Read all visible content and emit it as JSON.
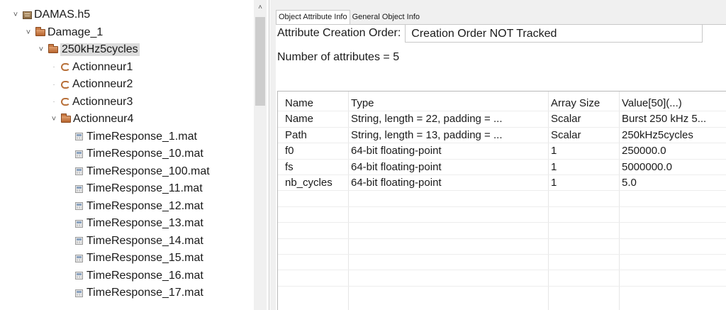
{
  "tree": {
    "items": [
      {
        "label": "DAMAS.h5",
        "icon": "hdf5-file-icon",
        "toggle": "˅",
        "indent": 0
      },
      {
        "label": "Damage_1",
        "icon": "group-folder-icon",
        "toggle": "˅",
        "indent": 1
      },
      {
        "label": "250kHz5cycles",
        "icon": "group-folder-icon",
        "toggle": "˅",
        "indent": 2,
        "selected": true
      },
      {
        "label": "Actionneur1",
        "icon": "subgroup-icon",
        "toggle": "·",
        "indent": 3
      },
      {
        "label": "Actionneur2",
        "icon": "subgroup-icon",
        "toggle": "·",
        "indent": 3
      },
      {
        "label": "Actionneur3",
        "icon": "subgroup-icon",
        "toggle": "·",
        "indent": 3
      },
      {
        "label": "Actionneur4",
        "icon": "group-folder-icon",
        "toggle": "˅",
        "indent": 3
      },
      {
        "label": "TimeResponse_1.mat",
        "icon": "dataset-icon",
        "indent": 4
      },
      {
        "label": "TimeResponse_10.mat",
        "icon": "dataset-icon",
        "indent": 4
      },
      {
        "label": "TimeResponse_100.mat",
        "icon": "dataset-icon",
        "indent": 4
      },
      {
        "label": "TimeResponse_11.mat",
        "icon": "dataset-icon",
        "indent": 4
      },
      {
        "label": "TimeResponse_12.mat",
        "icon": "dataset-icon",
        "indent": 4
      },
      {
        "label": "TimeResponse_13.mat",
        "icon": "dataset-icon",
        "indent": 4
      },
      {
        "label": "TimeResponse_14.mat",
        "icon": "dataset-icon",
        "indent": 4
      },
      {
        "label": "TimeResponse_15.mat",
        "icon": "dataset-icon",
        "indent": 4
      },
      {
        "label": "TimeResponse_16.mat",
        "icon": "dataset-icon",
        "indent": 4
      },
      {
        "label": "TimeResponse_17.mat",
        "icon": "dataset-icon",
        "indent": 4
      }
    ],
    "scroll_up_glyph": "˄"
  },
  "tabs": [
    {
      "label": "Object Attribute Info",
      "active": true
    },
    {
      "label": "General Object Info",
      "active": false
    }
  ],
  "attributes": {
    "creation_order_label": "Attribute Creation Order:",
    "creation_order_value": "Creation Order NOT Tracked",
    "count_text": "Number of attributes = 5",
    "columns": [
      "Name",
      "Type",
      "Array Size",
      "Value[50](...)"
    ],
    "rows": [
      [
        "Name",
        "String, length = 22, padding = ...",
        "Scalar",
        "Burst 250 kHz 5..."
      ],
      [
        "Path",
        "String, length = 13, padding = ...",
        "Scalar",
        "250kHz5cycles"
      ],
      [
        "f0",
        "64-bit floating-point",
        "1",
        "250000.0"
      ],
      [
        "fs",
        "64-bit floating-point",
        "1",
        "5000000.0"
      ],
      [
        "nb_cycles",
        "64-bit floating-point",
        "1",
        "5.0"
      ]
    ],
    "empty_rows": 6
  },
  "colors": {
    "selection": "#dcdcdc",
    "group_icon": "#c87a44",
    "panel_bg": "#f0f0f0"
  }
}
